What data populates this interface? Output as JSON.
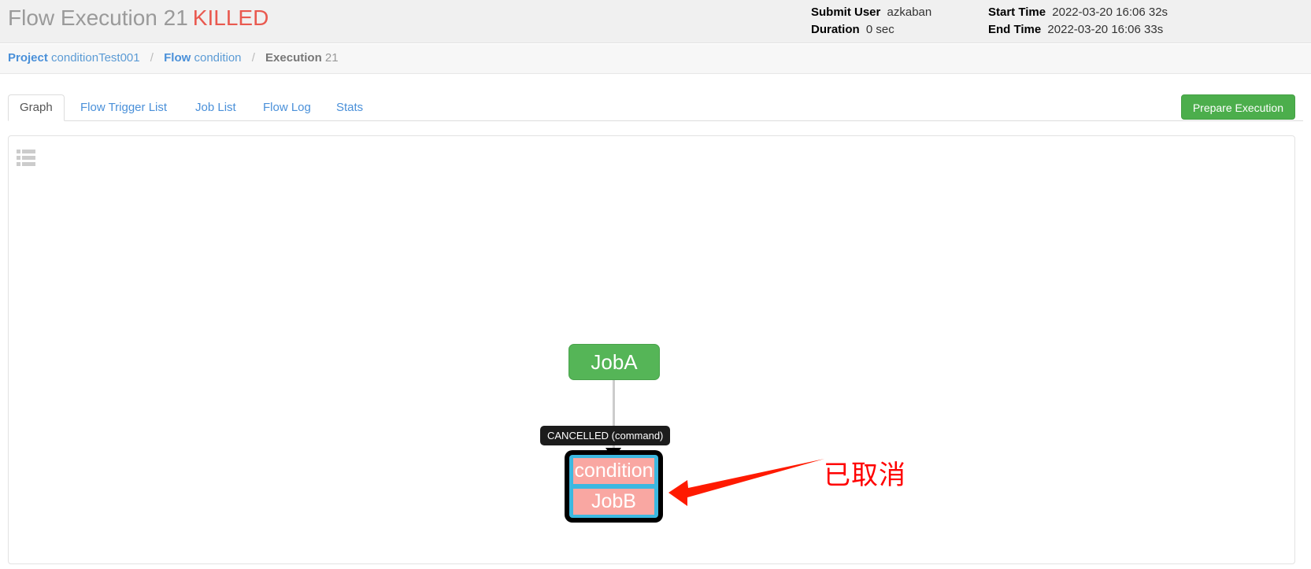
{
  "header": {
    "title_prefix": "Flow Execution 21",
    "status": "KILLED",
    "status_color": "#e9594f",
    "summary": [
      {
        "label": "Submit User",
        "value": "azkaban"
      },
      {
        "label": "Duration",
        "value": "0 sec"
      },
      {
        "label": "Start Time",
        "value": "2022-03-20 16:06 32s"
      },
      {
        "label": "End Time",
        "value": "2022-03-20 16:06 33s"
      }
    ]
  },
  "breadcrumb": {
    "project_key": "Project",
    "project_value": "conditionTest001",
    "flow_key": "Flow",
    "flow_value": "condition",
    "execution_key": "Execution",
    "execution_value": "21",
    "separator": "/"
  },
  "tabs": {
    "items": [
      {
        "label": "Graph",
        "active": true
      },
      {
        "label": "Flow Trigger List",
        "active": false
      },
      {
        "label": "Job List",
        "active": false
      },
      {
        "label": "Flow Log",
        "active": false
      },
      {
        "label": "Stats",
        "active": false
      }
    ],
    "prepare_button": "Prepare Execution",
    "prepare_button_color": "#4cae4c"
  },
  "graph": {
    "toolbar_icon": "table-list-icon",
    "nodes": [
      {
        "id": "JobA",
        "label": "JobA",
        "type": "job",
        "status": "SUCCEEDED",
        "color": "#55b557"
      },
      {
        "id": "JobB",
        "label_top": "condition",
        "label_bottom": "JobB",
        "type": "condition-job",
        "status": "CANCELLED",
        "outer_color": "#000000",
        "frame_color": "#3cb8e0",
        "fill_color": "#f9a7a2"
      }
    ],
    "edges": [
      {
        "from": "JobA",
        "to": "JobB",
        "label": "CANCELLED (command)",
        "label_bg": "#1c1c1c"
      }
    ],
    "annotation": {
      "text": "已取消",
      "color": "#ff0000",
      "arrow": "red-arrow-pointing-left"
    }
  }
}
